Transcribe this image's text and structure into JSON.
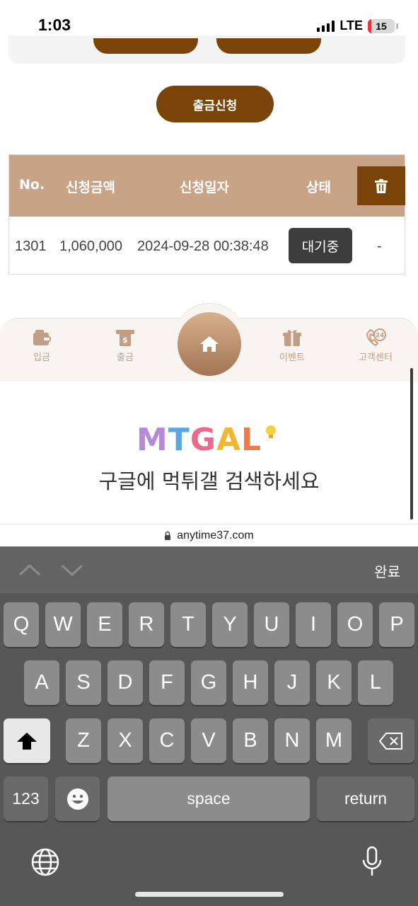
{
  "status_bar": {
    "time": "1:03",
    "network": "LTE",
    "battery": "15"
  },
  "withdraw_button": "출금신청",
  "table": {
    "headers": {
      "no": "No.",
      "amount": "신청금액",
      "date": "신청일자",
      "status": "상태"
    },
    "rows": [
      {
        "no": "1301",
        "amount": "1,060,000",
        "date": "2024-09-28 00:38:48",
        "status": "대기중",
        "action": "-"
      }
    ]
  },
  "nav": {
    "deposit": "입금",
    "withdraw": "출금",
    "event": "이벤트",
    "support": "고객센터",
    "support_badge": "24"
  },
  "banner": {
    "logo": "MTGAL",
    "text": "구글에 먹튀갤 검색하세요"
  },
  "url_bar": {
    "url": "anytime37.com"
  },
  "accessory": {
    "done": "완료"
  },
  "keyboard": {
    "row1": [
      "Q",
      "W",
      "E",
      "R",
      "T",
      "Y",
      "U",
      "I",
      "O",
      "P"
    ],
    "row2": [
      "A",
      "S",
      "D",
      "F",
      "G",
      "H",
      "J",
      "K",
      "L"
    ],
    "row3": [
      "Z",
      "X",
      "C",
      "V",
      "B",
      "N",
      "M"
    ],
    "numbers": "123",
    "space": "space",
    "return": "return"
  },
  "colors": {
    "brand_brown": "#7a4409",
    "table_header": "#c8a386",
    "nav_label": "#c49e84"
  }
}
